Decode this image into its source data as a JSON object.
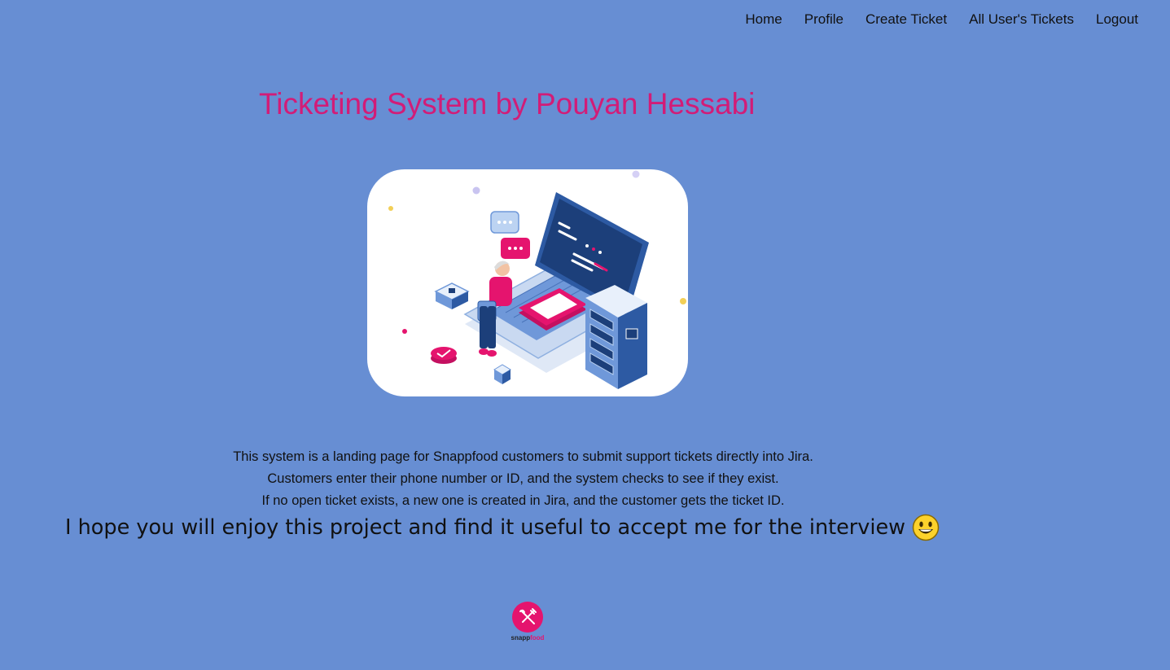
{
  "nav": {
    "items": [
      {
        "label": "Home"
      },
      {
        "label": "Profile"
      },
      {
        "label": "Create Ticket"
      },
      {
        "label": "All User's Tickets"
      },
      {
        "label": "Logout"
      }
    ]
  },
  "header": {
    "title": "Ticketing System by Pouyan Hessabi"
  },
  "hero": {
    "illustration": "laptop-server-illustration"
  },
  "description": {
    "lines": [
      "This system is a landing page for Snappfood customers to submit support tickets directly into Jira.",
      "Customers enter their phone number or ID, and the system checks to see if they exist.",
      "If no open ticket exists, a new one is created in Jira, and the customer gets the ticket ID."
    ]
  },
  "message": {
    "text": "I hope you will enjoy this project and find it useful to accept me for the interview",
    "emoji": "grinning-face-icon"
  },
  "footer": {
    "logo_word_part1": "snapp",
    "logo_word_part2": "food",
    "logo_icon": "fork-knife-icon"
  },
  "colors": {
    "background": "#678ed3",
    "title": "#d21c77",
    "brand": "#e5146e"
  }
}
